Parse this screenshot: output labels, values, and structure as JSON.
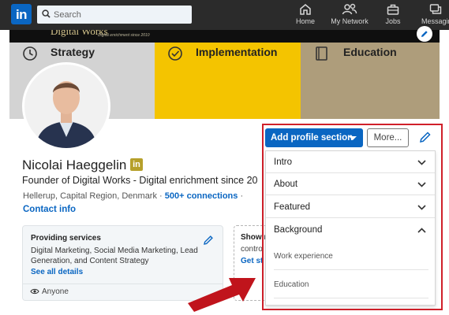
{
  "nav": {
    "logo": "in",
    "search_placeholder": "Search",
    "items": [
      {
        "label": "Home",
        "icon": "home-icon"
      },
      {
        "label": "My Network",
        "icon": "network-icon"
      },
      {
        "label": "Jobs",
        "icon": "briefcase-icon"
      },
      {
        "label": "Messaging",
        "icon": "messaging-icon"
      }
    ]
  },
  "banner": {
    "brand": "Digital Works",
    "tagline": "Digital enrichment since 2010",
    "bands": [
      {
        "label": "Strategy",
        "icon": "clock-icon",
        "color": "#d3d3d3"
      },
      {
        "label": "Implementation",
        "icon": "check-circle-icon",
        "color": "#f4c400"
      },
      {
        "label": "Education",
        "icon": "book-icon",
        "color": "#ae9d7b"
      }
    ]
  },
  "profile": {
    "name": "Nicolai Haeggelin",
    "badge": "in",
    "headline": "Founder of Digital Works - Digital enrichment since 20",
    "location": "Hellerup, Capital Region, Denmark",
    "separator": "·",
    "connections": "500+ connections",
    "contact_info": "Contact info"
  },
  "services_card": {
    "title": "Providing services",
    "description": "Digital Marketing, Social Media Marketing, Lead Generation, and Content Strategy",
    "link": "See all details",
    "visibility": "Anyone"
  },
  "open_card": {
    "title": "Show r",
    "description": "contro",
    "link": "Get st"
  },
  "actions": {
    "add_section": "Add profile section",
    "more": "More..."
  },
  "dropdown": {
    "sections": [
      {
        "label": "Intro",
        "expanded": false
      },
      {
        "label": "About",
        "expanded": false
      },
      {
        "label": "Featured",
        "expanded": false
      },
      {
        "label": "Background",
        "expanded": true
      }
    ],
    "background_items": [
      "Work experience",
      "Education"
    ]
  },
  "colors": {
    "accent": "#0a66c2",
    "highlight": "#d0202a",
    "topbar": "#2b2b2b"
  }
}
